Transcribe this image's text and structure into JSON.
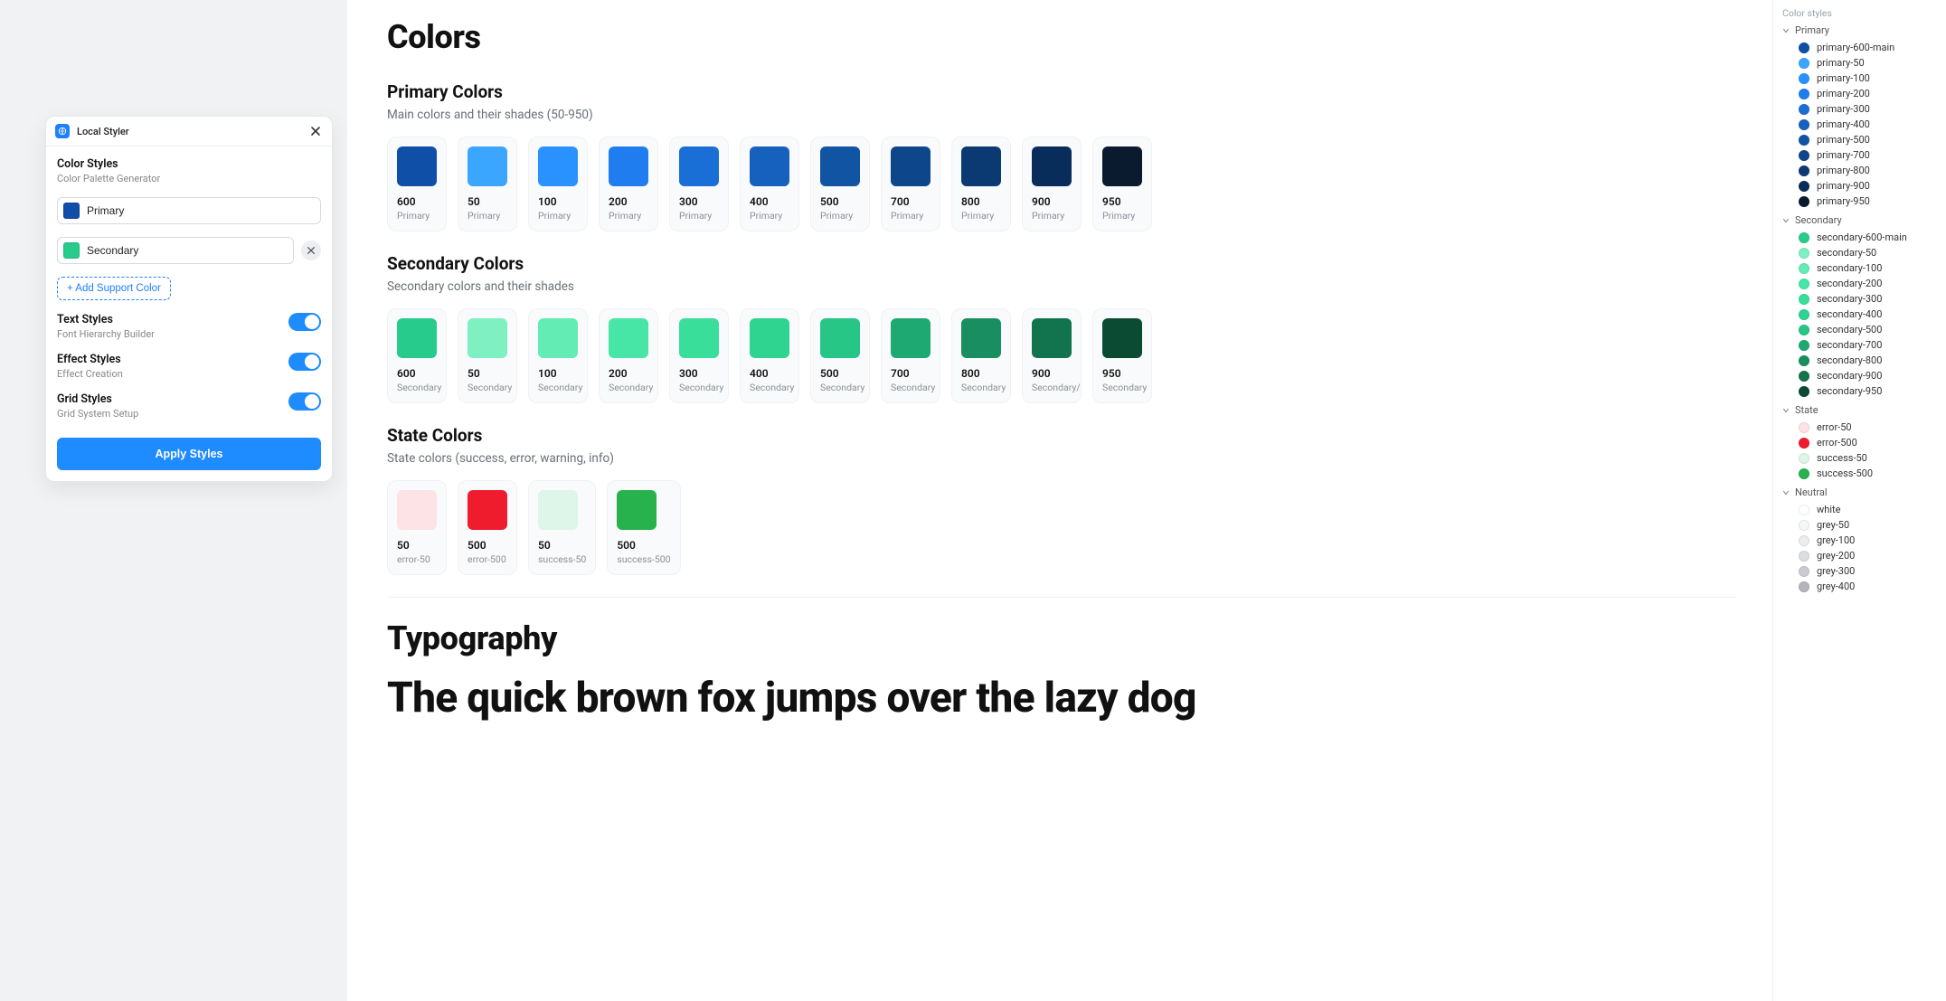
{
  "panel": {
    "title": "Local Styler",
    "section_color_styles": {
      "title": "Color Styles",
      "subtitle": "Color Palette Generator"
    },
    "colors": [
      {
        "name": "Primary",
        "hex": "#0f4fa8"
      },
      {
        "name": "Secondary",
        "hex": "#27cc8d"
      }
    ],
    "add_support_label": "+ Add Support Color",
    "toggles": [
      {
        "title": "Text Styles",
        "subtitle": "Font Hierarchy Builder",
        "on": true
      },
      {
        "title": "Effect Styles",
        "subtitle": "Effect Creation",
        "on": true
      },
      {
        "title": "Grid Styles",
        "subtitle": "Grid System Setup",
        "on": true
      }
    ],
    "apply_label": "Apply Styles"
  },
  "canvas": {
    "colors_heading": "Colors",
    "primary": {
      "title": "Primary Colors",
      "subtitle": "Main colors and their shades (50-950)",
      "family": "Primary",
      "swatches": [
        {
          "shade": "600",
          "hex": "#0f4fa8"
        },
        {
          "shade": "50",
          "hex": "#3aa6ff"
        },
        {
          "shade": "100",
          "hex": "#2a92ff"
        },
        {
          "shade": "200",
          "hex": "#1f7df0"
        },
        {
          "shade": "300",
          "hex": "#1a6fd6"
        },
        {
          "shade": "400",
          "hex": "#1661bd"
        },
        {
          "shade": "500",
          "hex": "#1254a4"
        },
        {
          "shade": "700",
          "hex": "#0e468b"
        },
        {
          "shade": "800",
          "hex": "#0b3a73"
        },
        {
          "shade": "900",
          "hex": "#082d5a"
        },
        {
          "shade": "950",
          "hex": "#0a1a2f"
        }
      ]
    },
    "secondary": {
      "title": "Secondary Colors",
      "subtitle": "Secondary colors and their shades",
      "family": "Secondary",
      "swatches": [
        {
          "shade": "600",
          "hex": "#27cc8d"
        },
        {
          "shade": "50",
          "hex": "#7ef0c2"
        },
        {
          "shade": "100",
          "hex": "#63ecb4"
        },
        {
          "shade": "200",
          "hex": "#48e6a6"
        },
        {
          "shade": "300",
          "hex": "#39de9b"
        },
        {
          "shade": "400",
          "hex": "#2fd491"
        },
        {
          "shade": "500",
          "hex": "#27c586"
        },
        {
          "shade": "700",
          "hex": "#1ea973"
        },
        {
          "shade": "800",
          "hex": "#188e61"
        },
        {
          "shade": "900",
          "hex": "#12734f"
        },
        {
          "shade": "950",
          "hex": "#0b4a33"
        }
      ],
      "family_900": "Secondary/"
    },
    "state": {
      "title": "State Colors",
      "subtitle": "State colors (success, error, warning, info)",
      "swatches": [
        {
          "shade": "50",
          "family": "error-50",
          "hex": "#fde2e6"
        },
        {
          "shade": "500",
          "family": "error-500",
          "hex": "#ef1c2d"
        },
        {
          "shade": "50",
          "family": "success-50",
          "hex": "#def5ea"
        },
        {
          "shade": "500",
          "family": "success-500",
          "hex": "#28b24e"
        }
      ]
    },
    "typography_heading": "Typography",
    "pangram": "The quick brown fox jumps over the lazy dog"
  },
  "sidebar": {
    "heading": "Color styles",
    "groups": [
      {
        "name": "Primary",
        "items": [
          {
            "label": "primary-600-main",
            "hex": "#0f4fa8"
          },
          {
            "label": "primary-50",
            "hex": "#3aa6ff"
          },
          {
            "label": "primary-100",
            "hex": "#2a92ff"
          },
          {
            "label": "primary-200",
            "hex": "#1f7df0"
          },
          {
            "label": "primary-300",
            "hex": "#1a6fd6"
          },
          {
            "label": "primary-400",
            "hex": "#1661bd"
          },
          {
            "label": "primary-500",
            "hex": "#1254a4"
          },
          {
            "label": "primary-700",
            "hex": "#0e468b"
          },
          {
            "label": "primary-800",
            "hex": "#0b3a73"
          },
          {
            "label": "primary-900",
            "hex": "#082d5a"
          },
          {
            "label": "primary-950",
            "hex": "#0a1a2f"
          }
        ]
      },
      {
        "name": "Secondary",
        "items": [
          {
            "label": "secondary-600-main",
            "hex": "#27cc8d"
          },
          {
            "label": "secondary-50",
            "hex": "#7ef0c2"
          },
          {
            "label": "secondary-100",
            "hex": "#63ecb4"
          },
          {
            "label": "secondary-200",
            "hex": "#48e6a6"
          },
          {
            "label": "secondary-300",
            "hex": "#39de9b"
          },
          {
            "label": "secondary-400",
            "hex": "#2fd491"
          },
          {
            "label": "secondary-500",
            "hex": "#27c586"
          },
          {
            "label": "secondary-700",
            "hex": "#1ea973"
          },
          {
            "label": "secondary-800",
            "hex": "#188e61"
          },
          {
            "label": "secondary-900",
            "hex": "#12734f"
          },
          {
            "label": "secondary-950",
            "hex": "#0b4a33"
          }
        ]
      },
      {
        "name": "State",
        "items": [
          {
            "label": "error-50",
            "hex": "#fde2e6"
          },
          {
            "label": "error-500",
            "hex": "#ef1c2d"
          },
          {
            "label": "success-50",
            "hex": "#def5ea"
          },
          {
            "label": "success-500",
            "hex": "#28b24e"
          }
        ]
      },
      {
        "name": "Neutral",
        "items": [
          {
            "label": "white",
            "hex": "#ffffff"
          },
          {
            "label": "grey-50",
            "hex": "#f6f7f8"
          },
          {
            "label": "grey-100",
            "hex": "#ececee"
          },
          {
            "label": "grey-200",
            "hex": "#dcdde0"
          },
          {
            "label": "grey-300",
            "hex": "#c9cbd0"
          },
          {
            "label": "grey-400",
            "hex": "#b2b5bc"
          }
        ]
      }
    ]
  }
}
